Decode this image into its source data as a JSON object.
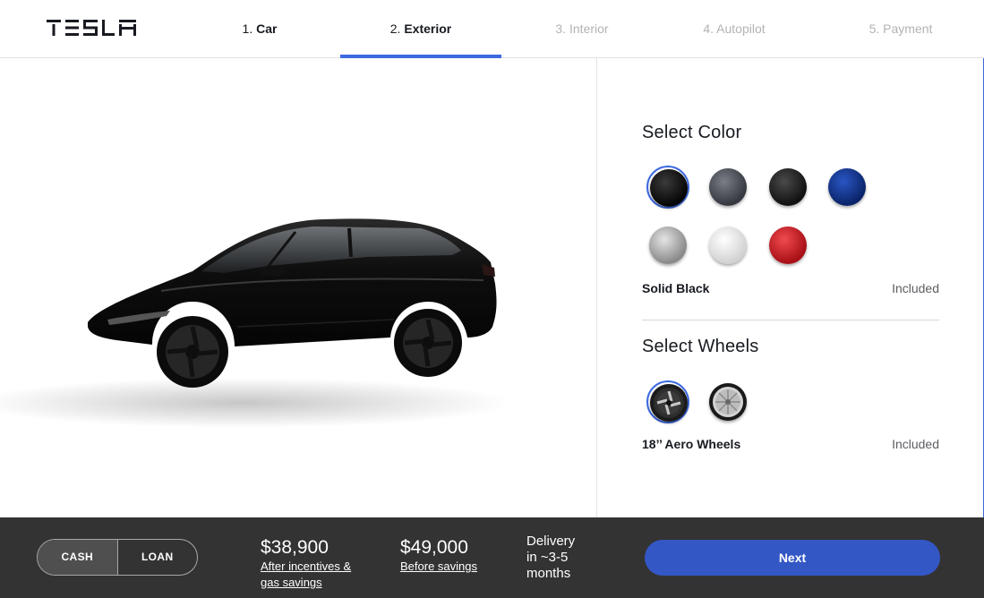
{
  "brand": {
    "logo_text": "TESLA"
  },
  "steps": [
    {
      "num": "1.",
      "label": "Car",
      "state": "done"
    },
    {
      "num": "2.",
      "label": "Exterior",
      "state": "active"
    },
    {
      "num": "3.",
      "label": "Interior",
      "state": "pending"
    },
    {
      "num": "4.",
      "label": "Autopilot",
      "state": "pending"
    },
    {
      "num": "5.",
      "label": "Payment",
      "state": "pending"
    }
  ],
  "color_section": {
    "title": "Select Color",
    "selected_name": "Solid Black",
    "selected_price": "Included",
    "swatches": [
      {
        "name": "solid-black",
        "color": "#0b0b0b",
        "selected": true
      },
      {
        "name": "midnight-silver",
        "color": "#4a4d55",
        "selected": false
      },
      {
        "name": "obsidian-black",
        "color": "#1d1d1d",
        "selected": false
      },
      {
        "name": "deep-blue",
        "color": "#0d2f7d",
        "selected": false
      },
      {
        "name": "silver",
        "color": "#a6a6a6",
        "selected": false
      },
      {
        "name": "pearl-white",
        "color": "#e9e9e9",
        "selected": false
      },
      {
        "name": "red",
        "color": "#c0141c",
        "selected": false
      }
    ]
  },
  "wheels_section": {
    "title": "Select Wheels",
    "selected_name": "18’’ Aero Wheels",
    "selected_price": "Included",
    "options": [
      {
        "name": "aero-wheels",
        "selected": true
      },
      {
        "name": "sport-wheels",
        "selected": false
      }
    ]
  },
  "footer": {
    "payment_options": [
      "CASH",
      "LOAN"
    ],
    "selected_payment": "CASH",
    "price_after": "$38,900",
    "price_after_label": "After incentives & gas savings",
    "price_after_line1": "After incentives &",
    "price_after_line2": "gas savings",
    "price_before": "$49,000",
    "price_before_label": "Before savings",
    "delivery_line1": "Delivery",
    "delivery_line2": "in ~3-5",
    "delivery_line3": "months",
    "next_label": "Next"
  },
  "colors": {
    "accent": "#3e6ae1",
    "footer_bg": "#333333",
    "next_button": "#3457c6"
  }
}
